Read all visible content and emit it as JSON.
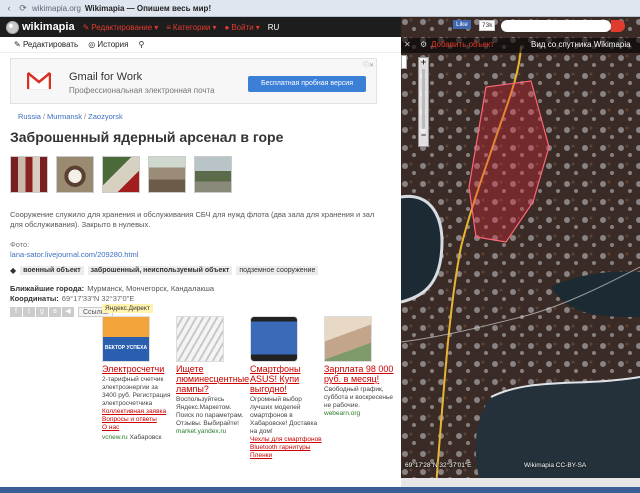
{
  "browser": {
    "url": "wikimapia.org",
    "title": "Wikimapia — Опишем весь мир!"
  },
  "site": {
    "logo_text": "wikimapia",
    "menu": [
      {
        "label": "Редактирование"
      },
      {
        "label": "Категории"
      },
      {
        "label": "Войти"
      }
    ],
    "lang": "RU"
  },
  "toolbar": {
    "edit_label": "Редактировать",
    "history_label": "История"
  },
  "ad": {
    "title": "Gmail for Work",
    "subtitle": "Профессиональная электронная почта",
    "button_label": "Бесплатная пробная версия",
    "brand_colors": [
      "#d93025",
      "#ffffff"
    ]
  },
  "breadcrumb": [
    "Russia",
    "Murmansk",
    "Zaozyorsk"
  ],
  "place": {
    "title": "Заброшенный ядерный арсенал в горе",
    "description": "Сооружение служило для хранения и обслуживания СБЧ для нужд флота (два зала для хранения и зал для обслуживания). Закрыто в нулевых.",
    "photo_label": "Фото:",
    "photo_link": "lana-sator.livejournal.com/209280.html",
    "tags": [
      "военный объект",
      "заброшенный, неиспользуемый объект",
      "подземное сооружение"
    ],
    "cities_label": "Ближайшие города:",
    "cities": "Мурманск,   Мончегорск,   Кандалакша",
    "coords_label": "Координаты:",
    "coords": "69°17'33\"N 32°37'0\"E",
    "share_link": "Ссылка"
  },
  "yandex": {
    "label": "Яндекс.Директ",
    "ads": [
      {
        "img_text": "ВЕКТОР УСПЕХА",
        "headline": "Электросчетчи",
        "text": "2-тарифный счетчик электроэнергии за 3400 руб. Регистрация электросчетчика",
        "links": [
          "Коллективная заявка",
          "Вопросы и ответы",
          "О нас"
        ],
        "domain": "vcnew.ru",
        "city": "Хабаровск"
      },
      {
        "img_text": "",
        "headline": "Ищете люминесцентные лампы?",
        "text": "Воспользуйтесь Яндекс.Маркетом. Поиск по параметрам. Отзывы. Выбирайте!",
        "links": [],
        "domain": "market.yandex.ru",
        "city": ""
      },
      {
        "img_text": "",
        "headline": "Смартфоны ASUS! Купи выгодно!",
        "text": "Огромный выбор лучших моделей смартфонов в Хабаровске! Доставка на дом!",
        "links": [
          "Чехлы для смартфонов",
          "Bluetooth гарнитуры",
          "Пленки"
        ],
        "domain": "",
        "city": ""
      },
      {
        "img_text": "",
        "headline": "Зарплата 98 000 руб. в месяц!",
        "text": "Свободный график, суббота и воскресенье не рабочие.",
        "links": [],
        "domain": "webearn.org",
        "city": ""
      }
    ]
  },
  "map": {
    "fb_like": "Like",
    "fb_count": "73k",
    "add_object": "Добавить объект",
    "satellite_label": "Вид со спутника Wikimapia",
    "coords": "69°17'28\"N 32°37'01\"E",
    "copyright": "Wikimapia CC-BY-SA",
    "polygon_color": "#e0283a"
  }
}
